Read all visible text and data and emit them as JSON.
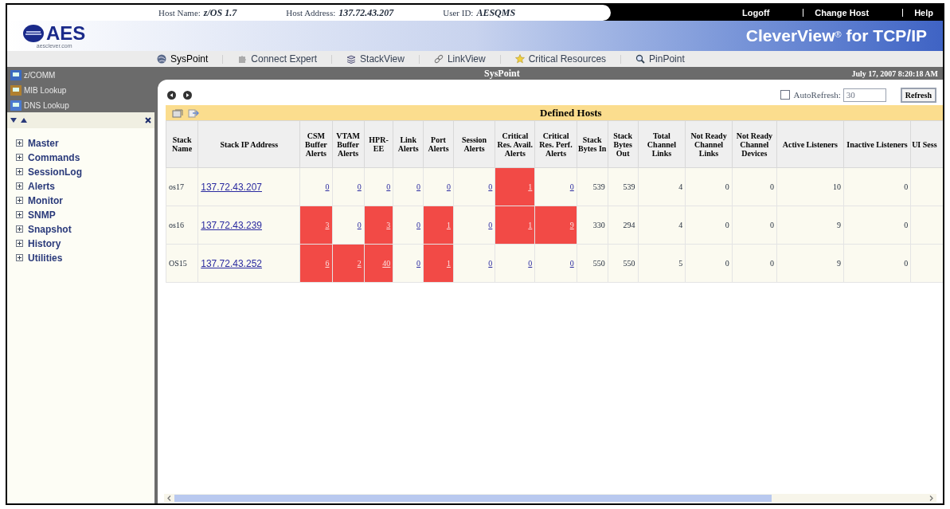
{
  "header": {
    "host_info": [
      {
        "label": "Host Name:",
        "value": "z/OS 1.7"
      },
      {
        "label": "Host Address:",
        "value": "137.72.43.207"
      },
      {
        "label": "User ID:",
        "value": "AESQMS"
      }
    ],
    "links": [
      "Logoff",
      "Change Host",
      "Help"
    ],
    "logo": "AES",
    "logo_sub": "aesclever.com",
    "product": "CleverView",
    "product_mark": "®",
    "product_suffix": "for TCP/IP"
  },
  "nav": [
    {
      "label": "SysPoint",
      "selected": true
    },
    {
      "label": "Connect Expert",
      "selected": false
    },
    {
      "label": "StackView",
      "selected": false
    },
    {
      "label": "LinkView",
      "selected": false
    },
    {
      "label": "Critical Resources",
      "selected": false
    },
    {
      "label": "PinPoint",
      "selected": false
    }
  ],
  "page_title": "SysPoint",
  "datetime": "July 17, 2007 8:20:18 AM",
  "sidebar": {
    "tools": [
      "z/COMM",
      "MIB Lookup",
      "DNS Lookup"
    ],
    "tree": [
      {
        "label": "Master",
        "expanded": false
      },
      {
        "label": "Commands",
        "expanded": false
      },
      {
        "label": "SessionLog",
        "expanded": false
      },
      {
        "label": "Alerts",
        "expanded": false
      },
      {
        "label": "Monitor",
        "expanded": false
      },
      {
        "label": "SNMP",
        "expanded": false
      },
      {
        "label": "Snapshot",
        "expanded": false
      },
      {
        "label": "History",
        "expanded": false
      },
      {
        "label": "Utilities",
        "expanded": false
      }
    ]
  },
  "autorefresh": {
    "label": "AutoRefresh:",
    "checked": false,
    "value": "30"
  },
  "refresh_button": "Refresh",
  "table": {
    "title": "Defined Hosts",
    "columns": [
      "Stack Name",
      "Stack IP Address",
      "CSM Buffer Alerts",
      "VTAM Buffer Alerts",
      "HPR-EE",
      "Link Alerts",
      "Port Alerts",
      "Session Alerts",
      "Critical Res. Avail. Alerts",
      "Critical Res. Perf. Alerts",
      "Stack Bytes In",
      "Stack Bytes Out",
      "Total Channel Links",
      "Not Ready Channel Links",
      "Not Ready Channel Devices",
      "Active Listeners",
      "Inactive Listeners",
      "UI Sess"
    ],
    "rows": [
      {
        "cells": [
          {
            "text": "os17",
            "kind": "text",
            "alert": false
          },
          {
            "text": "137.72.43.207",
            "kind": "link",
            "alert": false
          },
          {
            "text": "0",
            "kind": "link",
            "alert": false
          },
          {
            "text": "0",
            "kind": "link",
            "alert": false
          },
          {
            "text": "0",
            "kind": "link",
            "alert": false
          },
          {
            "text": "0",
            "kind": "link",
            "alert": false
          },
          {
            "text": "0",
            "kind": "link",
            "alert": false
          },
          {
            "text": "0",
            "kind": "link",
            "alert": false
          },
          {
            "text": "1",
            "kind": "link",
            "alert": true
          },
          {
            "text": "0",
            "kind": "link",
            "alert": false
          },
          {
            "text": "539",
            "kind": "text",
            "alert": false
          },
          {
            "text": "539",
            "kind": "text",
            "alert": false
          },
          {
            "text": "4",
            "kind": "text",
            "alert": false
          },
          {
            "text": "0",
            "kind": "text",
            "alert": false
          },
          {
            "text": "0",
            "kind": "text",
            "alert": false
          },
          {
            "text": "10",
            "kind": "text",
            "alert": false
          },
          {
            "text": "0",
            "kind": "text",
            "alert": false
          }
        ]
      },
      {
        "cells": [
          {
            "text": "os16",
            "kind": "text",
            "alert": false
          },
          {
            "text": "137.72.43.239",
            "kind": "link",
            "alert": false
          },
          {
            "text": "3",
            "kind": "link",
            "alert": true
          },
          {
            "text": "0",
            "kind": "link",
            "alert": false
          },
          {
            "text": "3",
            "kind": "link",
            "alert": true
          },
          {
            "text": "0",
            "kind": "link",
            "alert": false
          },
          {
            "text": "1",
            "kind": "link",
            "alert": true
          },
          {
            "text": "0",
            "kind": "link",
            "alert": false
          },
          {
            "text": "1",
            "kind": "link",
            "alert": true
          },
          {
            "text": "9",
            "kind": "link",
            "alert": true
          },
          {
            "text": "330",
            "kind": "text",
            "alert": false
          },
          {
            "text": "294",
            "kind": "text",
            "alert": false
          },
          {
            "text": "4",
            "kind": "text",
            "alert": false
          },
          {
            "text": "0",
            "kind": "text",
            "alert": false
          },
          {
            "text": "0",
            "kind": "text",
            "alert": false
          },
          {
            "text": "9",
            "kind": "text",
            "alert": false
          },
          {
            "text": "0",
            "kind": "text",
            "alert": false
          }
        ]
      },
      {
        "cells": [
          {
            "text": "OS15",
            "kind": "text",
            "alert": false
          },
          {
            "text": "137.72.43.252",
            "kind": "link",
            "alert": false
          },
          {
            "text": "6",
            "kind": "link",
            "alert": true
          },
          {
            "text": "2",
            "kind": "link",
            "alert": true
          },
          {
            "text": "40",
            "kind": "link",
            "alert": true
          },
          {
            "text": "0",
            "kind": "link",
            "alert": false
          },
          {
            "text": "1",
            "kind": "link",
            "alert": true
          },
          {
            "text": "0",
            "kind": "link",
            "alert": false
          },
          {
            "text": "0",
            "kind": "link",
            "alert": false
          },
          {
            "text": "0",
            "kind": "link",
            "alert": false
          },
          {
            "text": "550",
            "kind": "text",
            "alert": false
          },
          {
            "text": "550",
            "kind": "text",
            "alert": false
          },
          {
            "text": "5",
            "kind": "text",
            "alert": false
          },
          {
            "text": "0",
            "kind": "text",
            "alert": false
          },
          {
            "text": "0",
            "kind": "text",
            "alert": false
          },
          {
            "text": "9",
            "kind": "text",
            "alert": false
          },
          {
            "text": "0",
            "kind": "text",
            "alert": false
          }
        ]
      }
    ]
  }
}
